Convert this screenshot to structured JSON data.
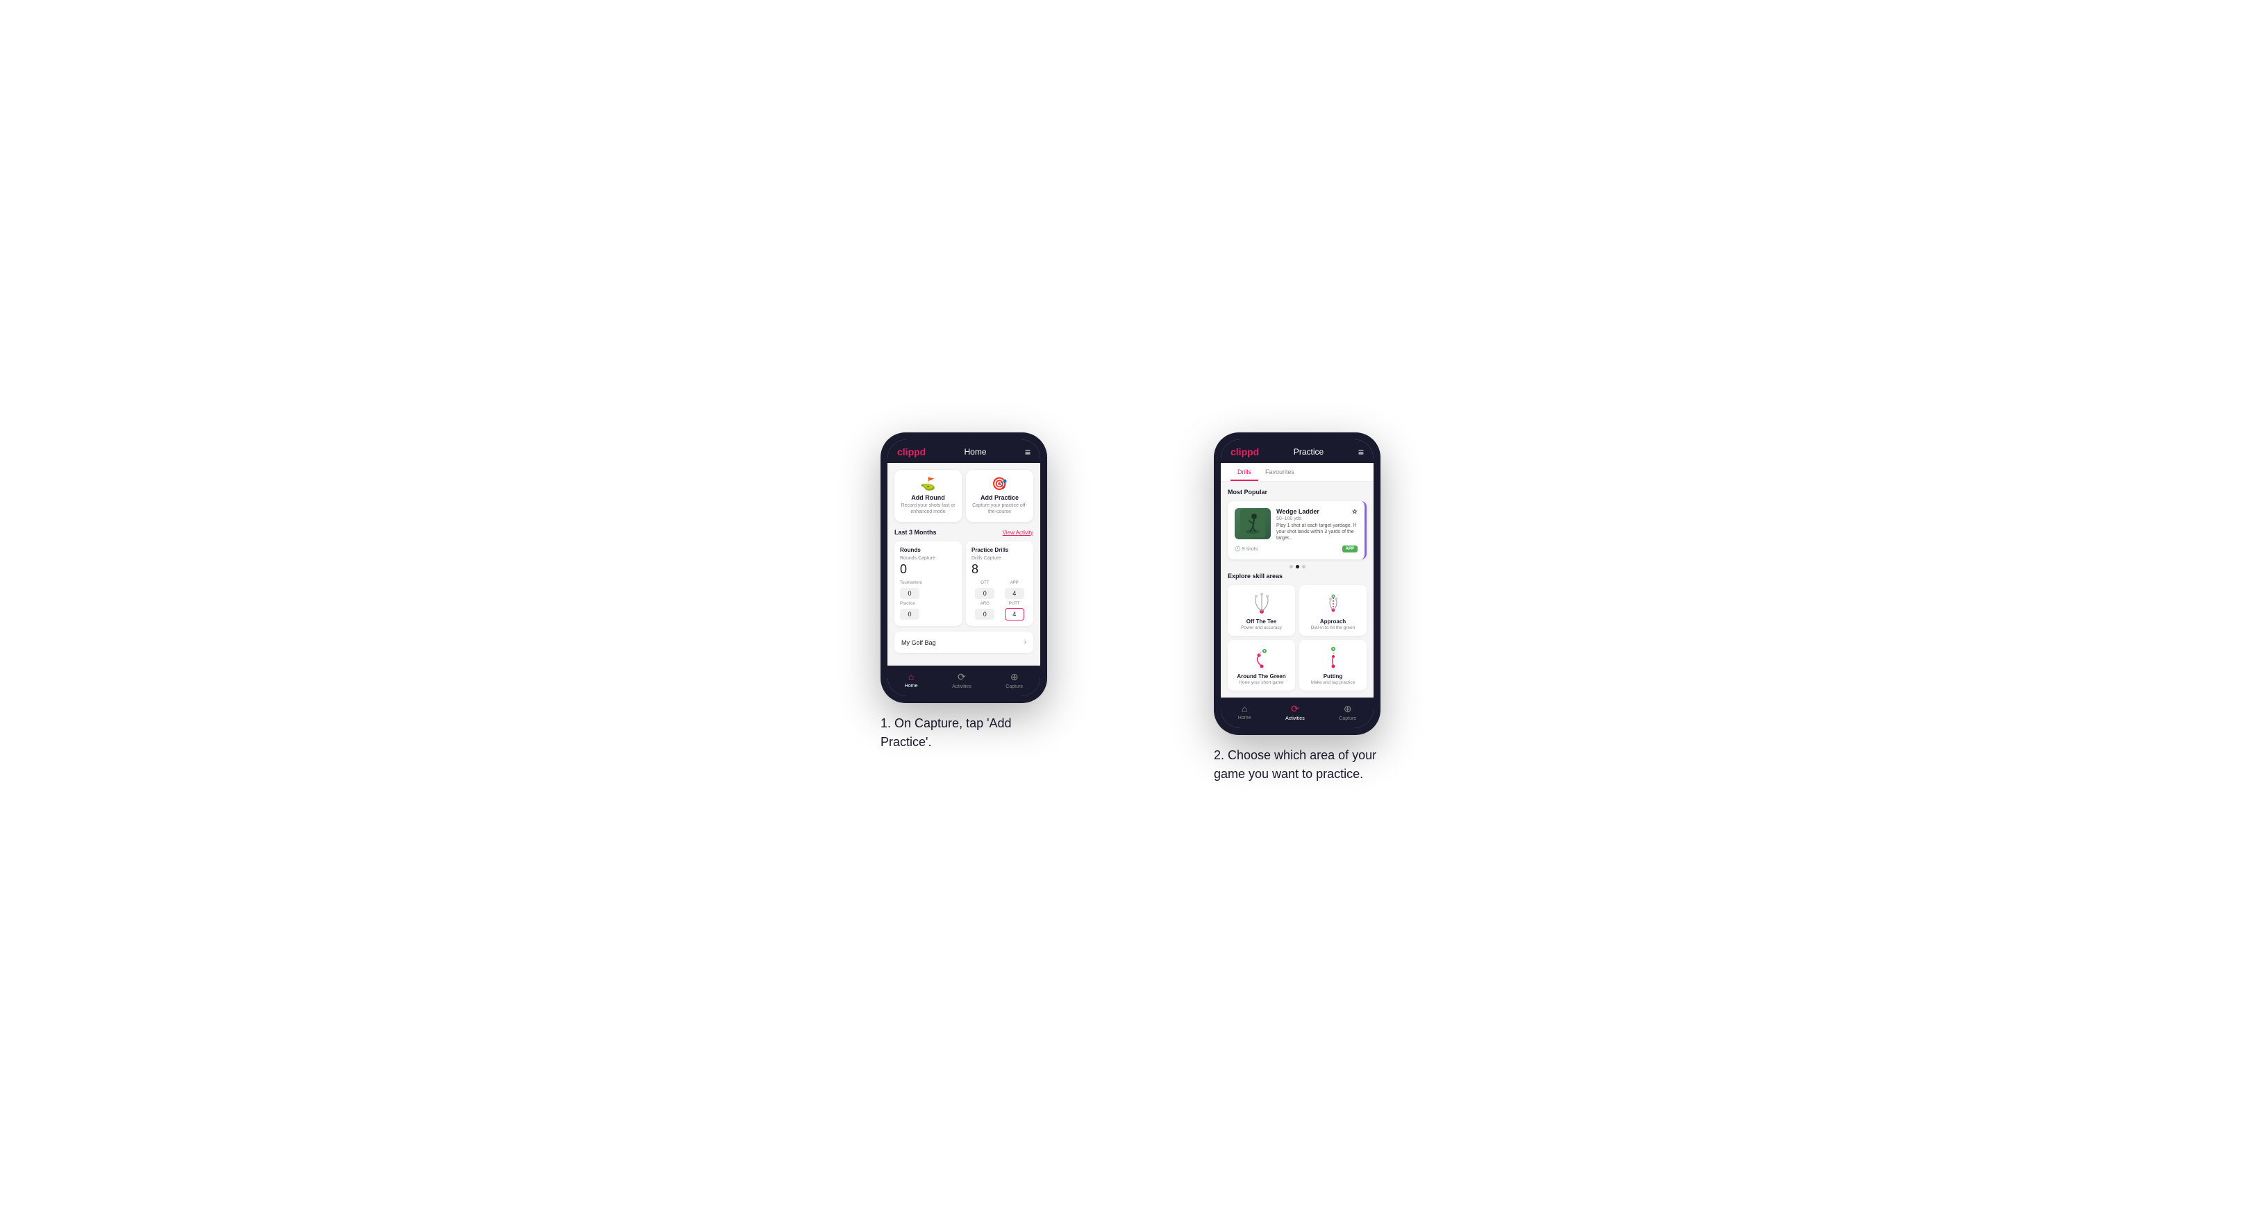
{
  "phone1": {
    "header": {
      "logo": "clippd",
      "title": "Home",
      "menu_icon": "≡"
    },
    "action_cards": [
      {
        "id": "add-round",
        "title": "Add Round",
        "description": "Record your shots fast or enhanced mode",
        "icon": "⛳"
      },
      {
        "id": "add-practice",
        "title": "Add Practice",
        "description": "Capture your practice off-the-course",
        "icon": "🎯"
      }
    ],
    "last3months": {
      "label": "Last 3 Months",
      "view_activity": "View Activity"
    },
    "rounds": {
      "title": "Rounds",
      "capture_label": "Rounds Capture",
      "capture_value": "0",
      "tournament_label": "Tournament",
      "tournament_value": "0",
      "practice_label": "Practice",
      "practice_value": "0"
    },
    "practice_drills": {
      "title": "Practice Drills",
      "capture_label": "Drills Capture",
      "capture_value": "8",
      "ott_label": "OTT",
      "ott_value": "0",
      "app_label": "APP",
      "app_value": "4",
      "arg_label": "ARG",
      "arg_value": "0",
      "putt_label": "PUTT",
      "putt_value": "4"
    },
    "my_golf_bag": "My Golf Bag",
    "bottom_nav": [
      {
        "label": "Home",
        "icon": "⌂",
        "active": true
      },
      {
        "label": "Activities",
        "icon": "♻",
        "active": false
      },
      {
        "label": "Capture",
        "icon": "⊕",
        "active": false
      }
    ]
  },
  "phone2": {
    "header": {
      "logo": "clippd",
      "title": "Practice",
      "menu_icon": "≡"
    },
    "tabs": [
      {
        "label": "Drills",
        "active": true
      },
      {
        "label": "Favourites",
        "active": false
      }
    ],
    "most_popular": {
      "title": "Most Popular",
      "card": {
        "name": "Wedge Ladder",
        "range": "50–100 yds",
        "description": "Play 1 shot at each target yardage. If your shot lands within 3 yards of the target..",
        "shots": "9 shots",
        "badge": "APP",
        "star_icon": "☆"
      },
      "dots": [
        false,
        true,
        false
      ]
    },
    "explore": {
      "title": "Explore skill areas",
      "skills": [
        {
          "name": "Off The Tee",
          "description": "Power and accuracy",
          "diagram_type": "off-the-tee"
        },
        {
          "name": "Approach",
          "description": "Dial-in to hit the green",
          "diagram_type": "approach"
        },
        {
          "name": "Around The Green",
          "description": "Hone your short game",
          "diagram_type": "around-the-green"
        },
        {
          "name": "Putting",
          "description": "Make and lag practice",
          "diagram_type": "putting"
        }
      ]
    },
    "bottom_nav": [
      {
        "label": "Home",
        "icon": "⌂",
        "active": false
      },
      {
        "label": "Activities",
        "icon": "♻",
        "active": true
      },
      {
        "label": "Capture",
        "icon": "⊕",
        "active": false
      }
    ]
  },
  "captions": {
    "phone1": "1. On Capture, tap 'Add Practice'.",
    "phone2": "2. Choose which area of your game you want to practice."
  }
}
